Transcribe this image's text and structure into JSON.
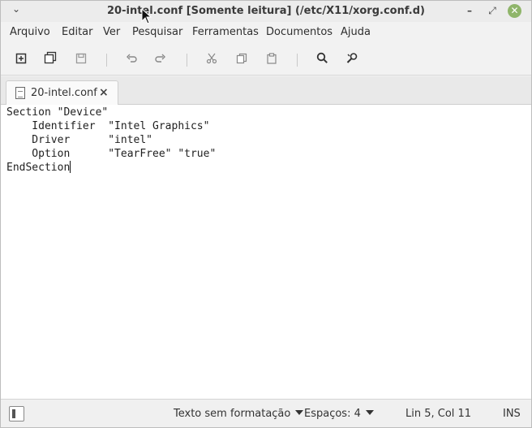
{
  "window": {
    "title": "20-intel.conf [Somente leitura] (/etc/X11/xorg.conf.d)"
  },
  "menubar": [
    "Arquivo",
    "Editar",
    "Ver",
    "Pesquisar",
    "Ferramentas",
    "Documentos",
    "Ajuda"
  ],
  "toolbar": {
    "icons": [
      "new-document-icon",
      "new-window-icon",
      "save-icon",
      "undo-icon",
      "redo-icon",
      "cut-icon",
      "copy-icon",
      "paste-icon",
      "search-icon",
      "replace-icon"
    ]
  },
  "tab": {
    "label": "20-intel.conf",
    "close": "×"
  },
  "editor": {
    "lines": [
      "Section \"Device\"",
      "    Identifier  \"Intel Graphics\"",
      "    Driver      \"intel\"",
      "    Option      \"TearFree\" \"true\"",
      "EndSection"
    ]
  },
  "statusbar": {
    "syntax": "Texto sem formatação",
    "spaces": "Espaços: 4",
    "position": "Lin 5, Col 11",
    "mode": "INS"
  },
  "colors": {
    "close_button": "#8fb56a",
    "editor_bg": "#ffffff",
    "chrome_bg": "#f2f2f2"
  }
}
